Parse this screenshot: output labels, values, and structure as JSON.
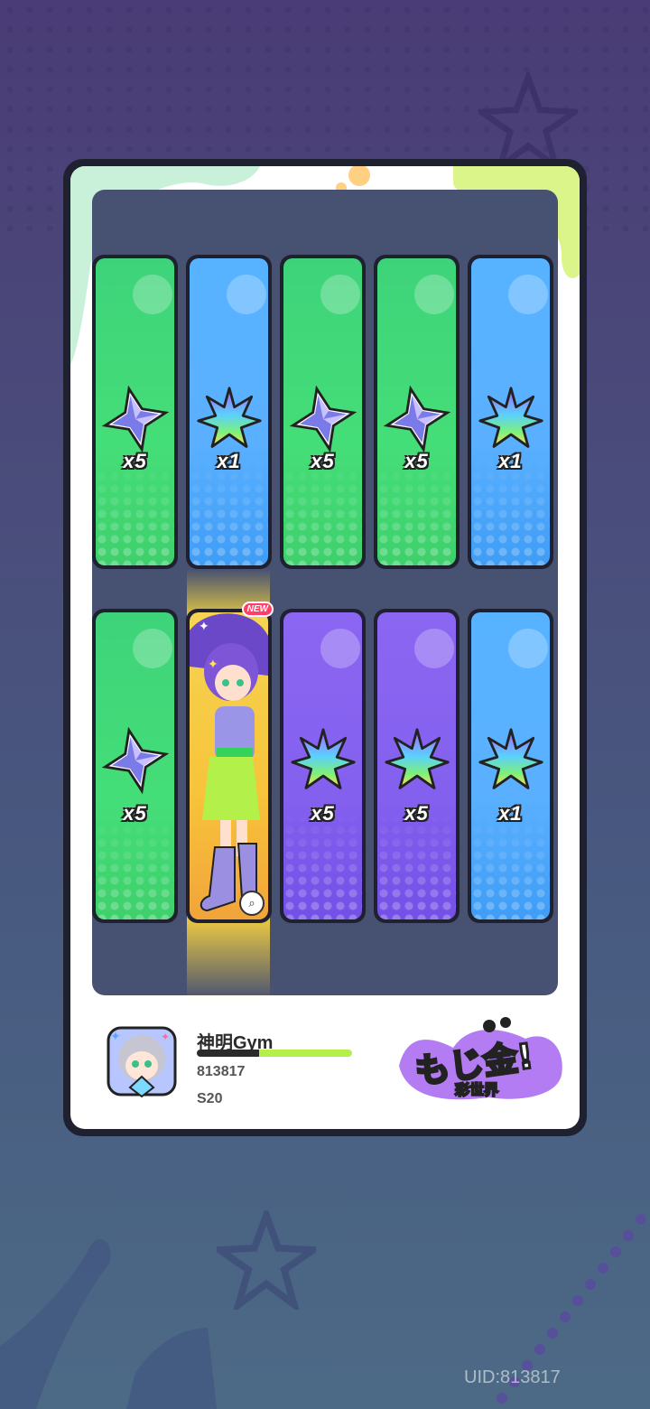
{
  "row1": [
    {
      "color": "green",
      "icon": "blue-star-shard-icon",
      "qty": "x5"
    },
    {
      "color": "blue",
      "icon": "rainbow-leaf-crystal-icon",
      "qty": "x1"
    },
    {
      "color": "green",
      "icon": "blue-star-shard-icon",
      "qty": "x5"
    },
    {
      "color": "green",
      "icon": "blue-star-shard-icon",
      "qty": "x5"
    },
    {
      "color": "blue",
      "icon": "rainbow-leaf-crystal-icon",
      "qty": "x1"
    }
  ],
  "row2": [
    {
      "color": "green",
      "icon": "blue-star-shard-icon",
      "qty": "x5"
    },
    {
      "color": "yellow",
      "icon": "character-card",
      "qty": "",
      "badge": "NEW"
    },
    {
      "color": "purple",
      "icon": "rainbow-leaf-crystal-icon",
      "qty": "x5"
    },
    {
      "color": "purple",
      "icon": "rainbow-leaf-crystal-icon",
      "qty": "x5"
    },
    {
      "color": "blue",
      "icon": "rainbow-leaf-crystal-icon",
      "qty": "x1"
    }
  ],
  "badge_new": "NEW",
  "player": {
    "name": "神明Gym",
    "id": "813817",
    "season": "S20"
  },
  "logo_sub": "彩世界",
  "uid_label": "UID:813817",
  "colors": {
    "green": "#44de78",
    "blue": "#5ab0ff",
    "purple": "#8460ef",
    "panel": "#475172",
    "accent": "#b4f04a"
  }
}
